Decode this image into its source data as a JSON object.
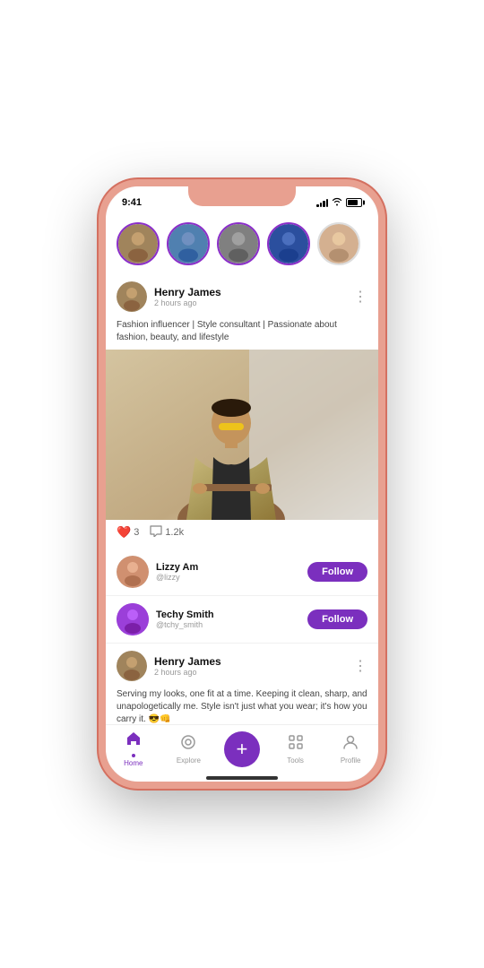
{
  "phone": {
    "status_bar": {
      "time": "9:41"
    }
  },
  "stories": [
    {
      "id": 1,
      "color": "#8B7355",
      "active": true
    },
    {
      "id": 2,
      "color": "#5B8FBE",
      "active": true
    },
    {
      "id": 3,
      "color": "#7B7B7B",
      "active": true
    },
    {
      "id": 4,
      "color": "#2B4F8E",
      "active": true
    },
    {
      "id": 5,
      "color": "#C4A882",
      "active": false
    }
  ],
  "post1": {
    "user_name": "Henry James",
    "post_time": "2 hours ago",
    "caption": "Fashion influencer | Style consultant | Passionate about fashion, beauty, and lifestyle",
    "likes": "3",
    "comments": "1.2k"
  },
  "suggestions": [
    {
      "name": "Lizzy Am",
      "handle": "@lizzy",
      "follow_label": "Follow"
    },
    {
      "name": "Techy Smith",
      "handle": "@tchy_smith",
      "follow_label": "Follow"
    }
  ],
  "post2": {
    "user_name": "Henry James",
    "post_time": "2 hours ago",
    "caption": "Serving my looks, one fit at a time. Keeping it clean, sharp, and unapologetically me. Style isn't just what you wear; it's how you carry it. 😎👊"
  },
  "bottom_nav": {
    "items": [
      {
        "label": "Home",
        "active": true
      },
      {
        "label": "Explore",
        "active": false
      },
      {
        "label": "Add",
        "active": false
      },
      {
        "label": "Tools",
        "active": false
      },
      {
        "label": "Profile",
        "active": false
      }
    ]
  }
}
